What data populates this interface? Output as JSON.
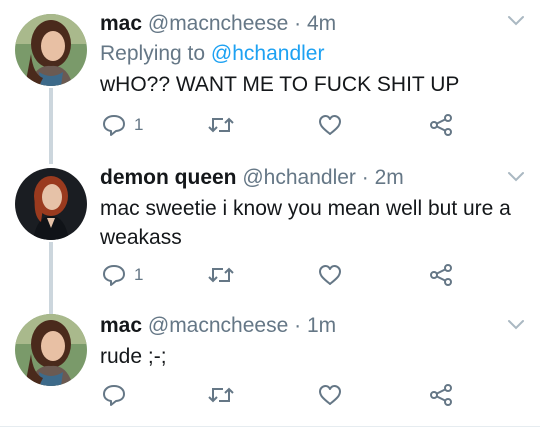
{
  "tweets": [
    {
      "name": "mac",
      "handle": "@macncheese",
      "separator": "·",
      "time": "4m",
      "replying_prefix": "Replying to",
      "replying_to": "@hchandler",
      "text": "wHO?? WANT ME TO FUCK SHIT UP",
      "reply_count": "1",
      "retweet_count": "",
      "like_count": ""
    },
    {
      "name": "demon queen",
      "handle": "@hchandler",
      "separator": "·",
      "time": "2m",
      "text": "mac sweetie i know you mean well but ure a weakass",
      "reply_count": "1",
      "retweet_count": "",
      "like_count": ""
    },
    {
      "name": "mac",
      "handle": "@macncheese",
      "separator": "·",
      "time": "1m",
      "text": "rude ;-;",
      "reply_count": "",
      "retweet_count": "",
      "like_count": ""
    }
  ],
  "icons": {
    "reply": "reply-icon",
    "retweet": "retweet-icon",
    "like": "heart-icon",
    "share": "share-icon",
    "menu": "chevron-down-icon"
  },
  "colors": {
    "link": "#1da1f2",
    "muted": "#657786",
    "thread_line": "#ccd6dd",
    "text": "#14171a"
  }
}
